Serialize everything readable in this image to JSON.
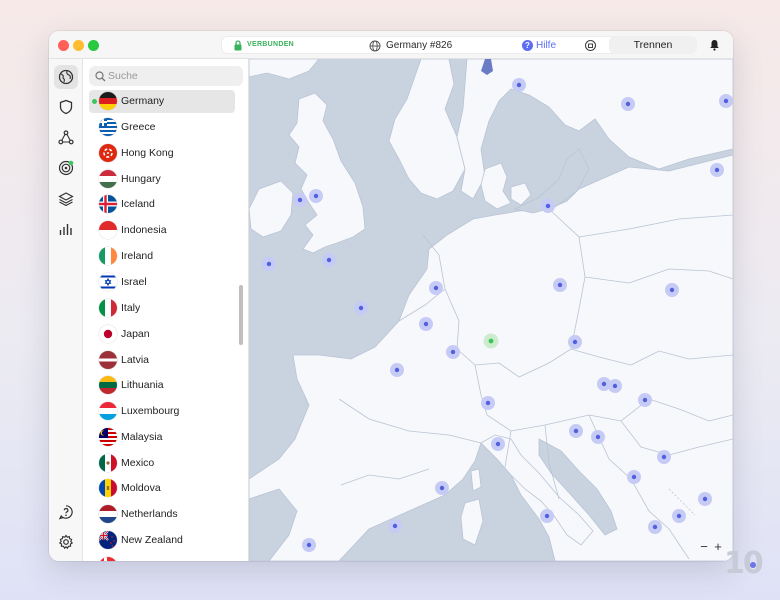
{
  "titlebar": {
    "status": "VERBUNDEN",
    "server": "Germany #826",
    "help_label": "Hilfe",
    "help_icon_glyph": "?",
    "disconnect_label": "Trennen"
  },
  "colors": {
    "connected": "#38b25b",
    "accent": "#5b6df6",
    "land": "#f7f8fb",
    "water": "#c9d3e0",
    "border": "#b9c4d4"
  },
  "rail": {
    "icons": [
      "globe-icon",
      "shield-icon",
      "meshnet-icon",
      "target-icon",
      "layers-icon",
      "stats-icon",
      "help-circle-icon",
      "gear-icon"
    ]
  },
  "search": {
    "placeholder": "Suche",
    "value": ""
  },
  "countries": [
    {
      "name": "Germany",
      "selected": true,
      "connected": true
    },
    {
      "name": "Greece"
    },
    {
      "name": "Hong Kong"
    },
    {
      "name": "Hungary"
    },
    {
      "name": "Iceland"
    },
    {
      "name": "Indonesia"
    },
    {
      "name": "Ireland"
    },
    {
      "name": "Israel"
    },
    {
      "name": "Italy"
    },
    {
      "name": "Japan"
    },
    {
      "name": "Latvia"
    },
    {
      "name": "Lithuania"
    },
    {
      "name": "Luxembourg"
    },
    {
      "name": "Malaysia"
    },
    {
      "name": "Mexico"
    },
    {
      "name": "Moldova"
    },
    {
      "name": "Netherlands"
    },
    {
      "name": "New Zealand"
    }
  ],
  "map": {
    "zoom_out": "−",
    "zoom_in": "+"
  },
  "watermark": "10"
}
